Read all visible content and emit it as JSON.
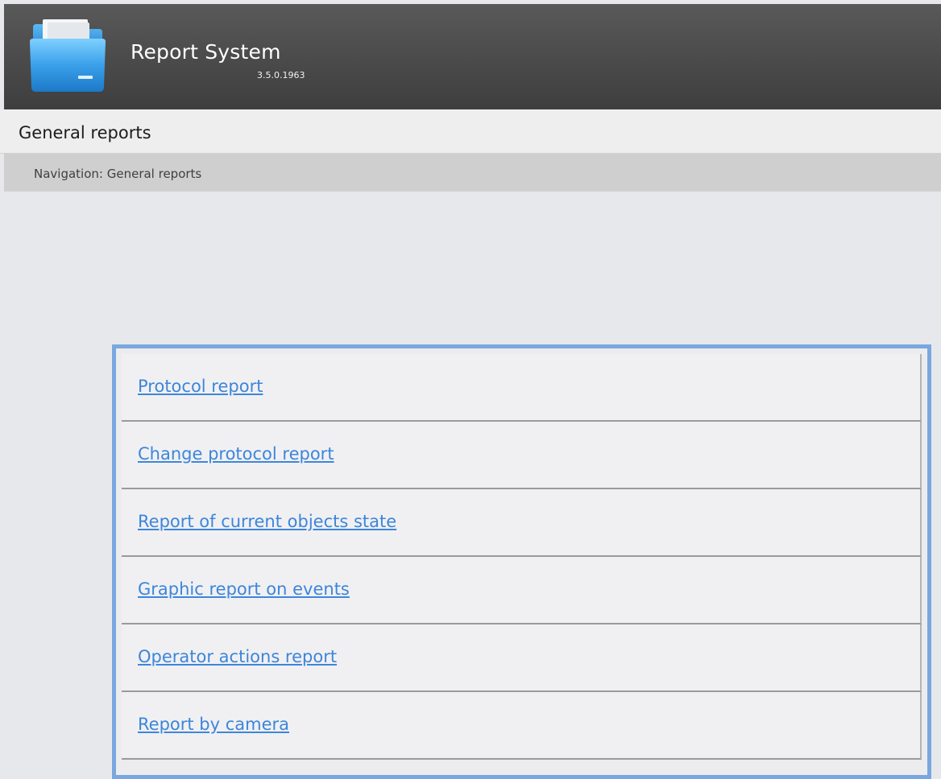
{
  "header": {
    "app_title": "Report System",
    "version": "3.5.0.1963",
    "logo_icon": "folder-icon"
  },
  "section": {
    "title": "General reports"
  },
  "breadcrumb": {
    "text": "Navigation: General reports"
  },
  "reports": [
    {
      "label": "Protocol report"
    },
    {
      "label": "Change protocol report"
    },
    {
      "label": "Report of current objects state"
    },
    {
      "label": "Graphic report on events"
    },
    {
      "label": "Operator actions report"
    },
    {
      "label": "Report by camera"
    }
  ],
  "colors": {
    "accent_border": "#7aa7df",
    "link": "#3d86d9",
    "header_bg": "#4a4a4a"
  }
}
